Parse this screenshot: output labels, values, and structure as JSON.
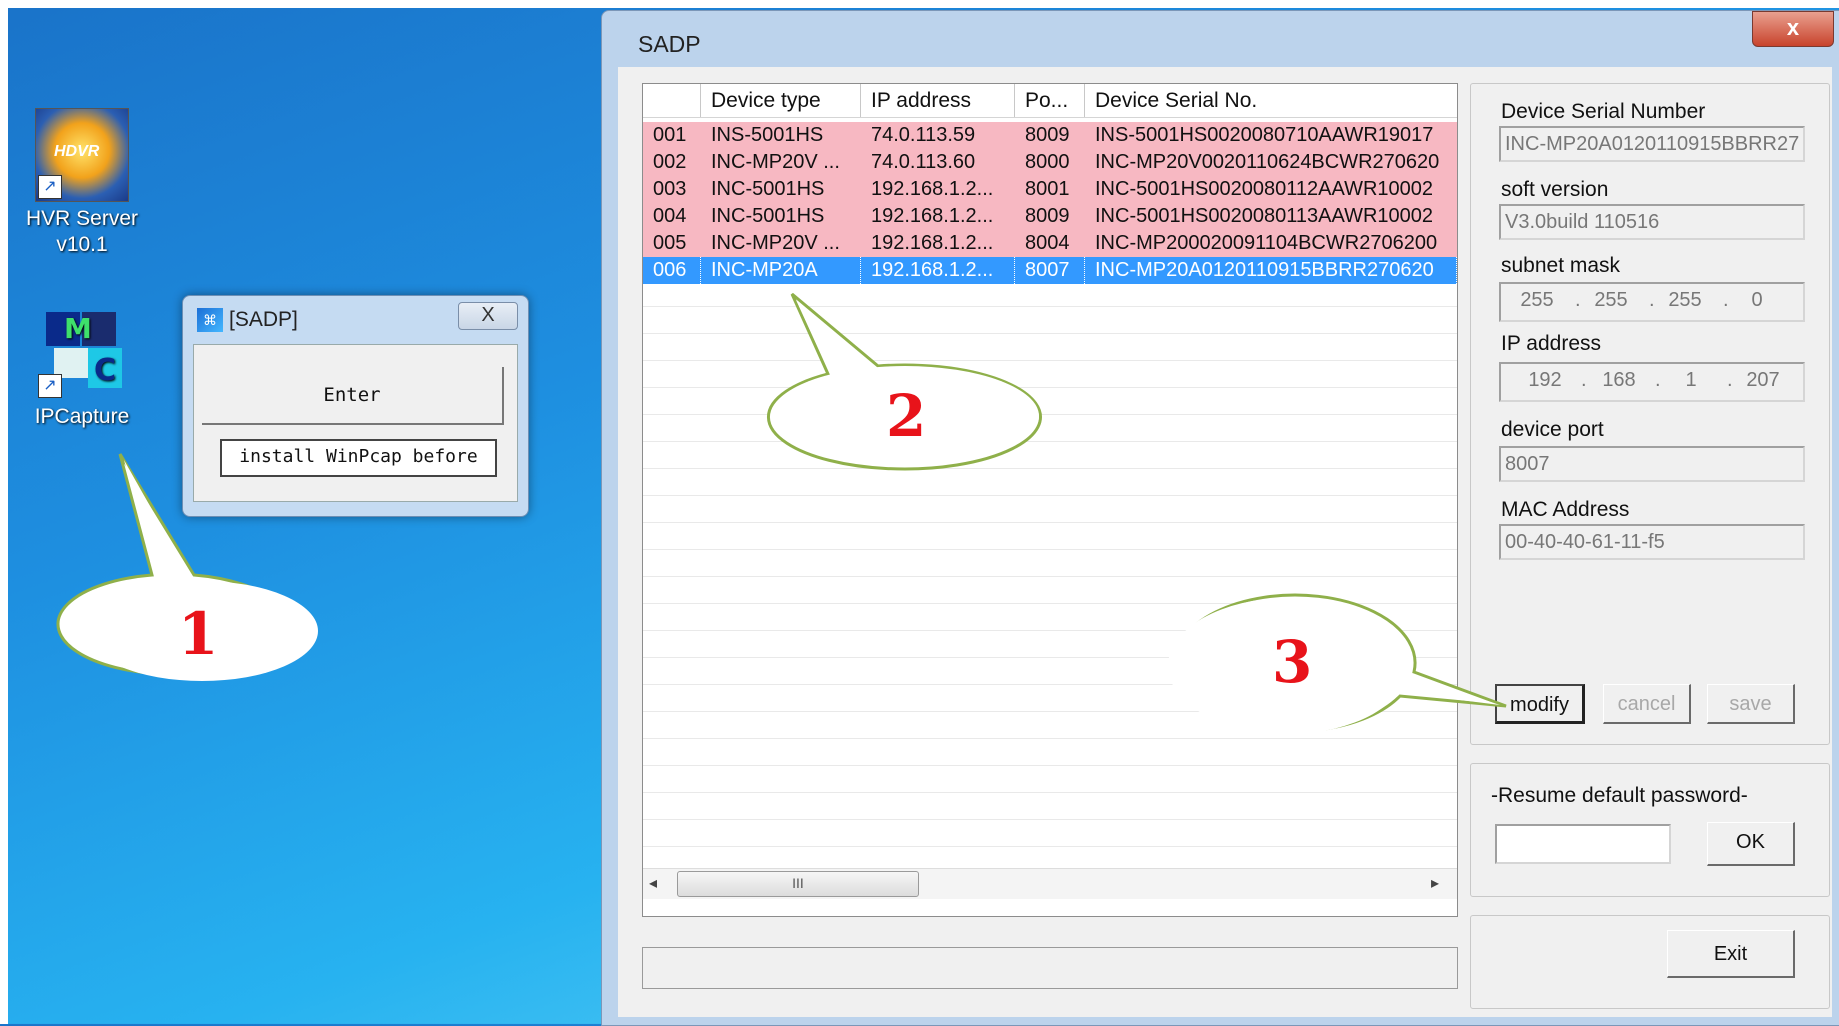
{
  "desktop": {
    "icons": [
      {
        "line1": "HVR Server",
        "line2": "v10.1",
        "badge": "HDVR"
      },
      {
        "line1": "IPCapture"
      }
    ]
  },
  "small_window": {
    "title": "[SADP]",
    "close": "X",
    "enter_label": "Enter",
    "note": "install WinPcap before"
  },
  "main_window": {
    "title": "SADP",
    "close": "x",
    "columns": [
      "Device type",
      "IP address",
      "Po...",
      "Device Serial No."
    ],
    "rows": [
      {
        "no": "001",
        "type": "INS-5001HS",
        "ip": "74.0.113.59",
        "port": "8009",
        "serial": "INS-5001HS0020080710AAWR19017",
        "state": "pink"
      },
      {
        "no": "002",
        "type": "INC-MP20V ...",
        "ip": "74.0.113.60",
        "port": "8000",
        "serial": "INC-MP20V0020110624BCWR270620",
        "state": "pink"
      },
      {
        "no": "003",
        "type": "INC-5001HS",
        "ip": "192.168.1.2...",
        "port": "8001",
        "serial": "INC-5001HS0020080112AAWR10002",
        "state": "pink"
      },
      {
        "no": "004",
        "type": "INC-5001HS",
        "ip": "192.168.1.2...",
        "port": "8009",
        "serial": "INC-5001HS0020080113AAWR10002",
        "state": "pink"
      },
      {
        "no": "005",
        "type": "INC-MP20V ...",
        "ip": "192.168.1.2...",
        "port": "8004",
        "serial": "INC-MP200020091104BCWR2706200",
        "state": "pink"
      },
      {
        "no": "006",
        "type": "INC-MP20A",
        "ip": "192.168.1.2...",
        "port": "8007",
        "serial": "INC-MP20A0120110915BBRR270620",
        "state": "selected"
      }
    ],
    "scroll_thumb": "III"
  },
  "details": {
    "serial_label": "Device Serial Number",
    "serial_value": "INC-MP20A0120110915BBRR27",
    "soft_label": "soft version",
    "soft_value": "V3.0build 110516",
    "mask_label": "subnet mask",
    "mask": [
      "255",
      "255",
      "255",
      "0"
    ],
    "ip_label": "IP address",
    "ip": [
      "192",
      "168",
      "1",
      "207"
    ],
    "port_label": "device port",
    "port_value": "8007",
    "mac_label": "MAC Address",
    "mac_value": "00-40-40-61-11-f5",
    "modify": "modify",
    "cancel": "cancel",
    "save": "save"
  },
  "password": {
    "label": "-Resume default password-",
    "ok": "OK"
  },
  "exit": "Exit",
  "callouts": [
    "1",
    "2",
    "3"
  ],
  "colors": {
    "callout_fill": "#ffffff",
    "callout_stroke": "#8fb04a",
    "callout_text": "#e8131a",
    "row_pink": "#f7b8c2",
    "row_selected": "#3399ff"
  }
}
